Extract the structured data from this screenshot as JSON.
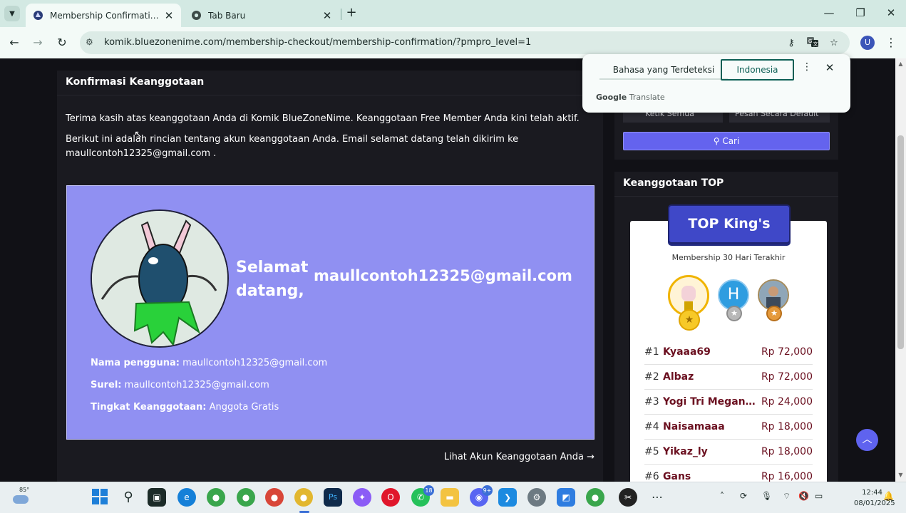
{
  "browser": {
    "tabs": [
      {
        "title": "Membership Confirmation – Ko",
        "active": true
      },
      {
        "title": "Tab Baru",
        "active": false
      }
    ],
    "url": "komik.bluezonenime.com/membership-checkout/membership-confirmation/?pmpro_level=1",
    "profile_initial": "U"
  },
  "main": {
    "heading": "Konfirmasi Keanggotaan",
    "para1": "Terima kasih atas keanggotaan Anda di Komik BlueZoneNime. Keanggotaan Free Member Anda kini telah aktif.",
    "para2": "Berikut ini adalah rincian tentang akun keanggotaan Anda. Email selamat datang telah dikirim ke maullcontoh12325@gmail.com .",
    "welcome_word": "Selamat datang,",
    "welcome_email": "maullcontoh12325@gmail.com",
    "username_label": "Nama pengguna:",
    "username_value": "maullcontoh12325@gmail.com",
    "email_label": "Surel:",
    "email_value": "maullcontoh12325@gmail.com",
    "level_label": "Tingkat Keanggotaan:",
    "level_value": "Anggota Gratis",
    "account_link": "Lihat Akun Keanggotaan Anda →"
  },
  "sidebar": {
    "select1": "Ketik Semua",
    "select2": "Pesan Secara Default",
    "search_label": "Cari",
    "top_heading": "Keanggotaan TOP",
    "badge": "TOP King's",
    "subtitle": "Membership 30 Hari Terakhir",
    "medal_h_letter": "H",
    "leaders": [
      {
        "rank": "#1",
        "name": "Kyaaa69",
        "amount": "Rp 72,000"
      },
      {
        "rank": "#2",
        "name": "Albaz",
        "amount": "Rp 72,000"
      },
      {
        "rank": "#3",
        "name": "Yogi Tri Meganan...",
        "amount": "Rp 24,000"
      },
      {
        "rank": "#4",
        "name": "Naisamaaa",
        "amount": "Rp 18,000"
      },
      {
        "rank": "#5",
        "name": "Yikaz_ly",
        "amount": "Rp 18,000"
      },
      {
        "rank": "#6",
        "name": "Gans",
        "amount": "Rp 16,000"
      }
    ]
  },
  "translate_popup": {
    "detected_tab": "Bahasa yang Terdeteksi",
    "target_tab": "Indonesia",
    "brand_google": "Google",
    "brand_translate": "Translate"
  },
  "taskbar": {
    "temperature": "85°",
    "badge_whatsapp": "18",
    "badge_discord": "9+",
    "time": "12:44",
    "date": "08/01/2025"
  },
  "colors": {
    "accent": "#6463ee",
    "welcome_bg": "#9090f2",
    "card_bg": "#1a1a20",
    "leader_name": "#6b1020"
  }
}
